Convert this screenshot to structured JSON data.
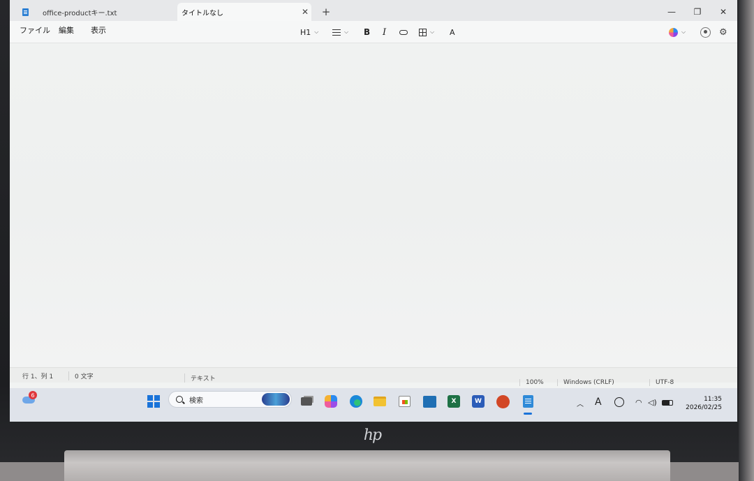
{
  "tabs": [
    {
      "label": "office-productキー.txt"
    },
    {
      "label": "タイトルなし"
    }
  ],
  "new_tab_label": "+",
  "menu": {
    "file": "ファイル",
    "edit": "編集",
    "view": "表示"
  },
  "toolbar": {
    "heading": "H1",
    "bold": "B",
    "italic": "I",
    "clear_format": "A"
  },
  "statusbar": {
    "position": "行 1、列 1",
    "char_count": "0 文字",
    "format": "テキスト",
    "zoom": "100%",
    "line_ending": "Windows (CRLF)",
    "encoding": "UTF-8"
  },
  "taskbar": {
    "weather_badge": "6",
    "search_placeholder": "検索",
    "tray_ime": "A",
    "time": "11:35",
    "date": "2026/02/25"
  },
  "icons": [
    "notepad-icon",
    "close-icon",
    "plus-icon",
    "minimize-icon",
    "maximize-icon",
    "list-icon",
    "link-icon",
    "table-icon",
    "clear-format-icon",
    "copilot-icon",
    "account-icon",
    "gear-icon",
    "windows-start-icon",
    "search-icon",
    "task-view-icon",
    "edge-icon",
    "folder-icon",
    "store-icon",
    "excel-icon",
    "word-icon",
    "powerpoint-icon",
    "wifi-icon",
    "speaker-icon",
    "battery-icon"
  ],
  "colors": {
    "accent": "#1a73d9",
    "editor_bg": "#f0f2f1",
    "taskbar_bg": "#dfe3ea"
  }
}
